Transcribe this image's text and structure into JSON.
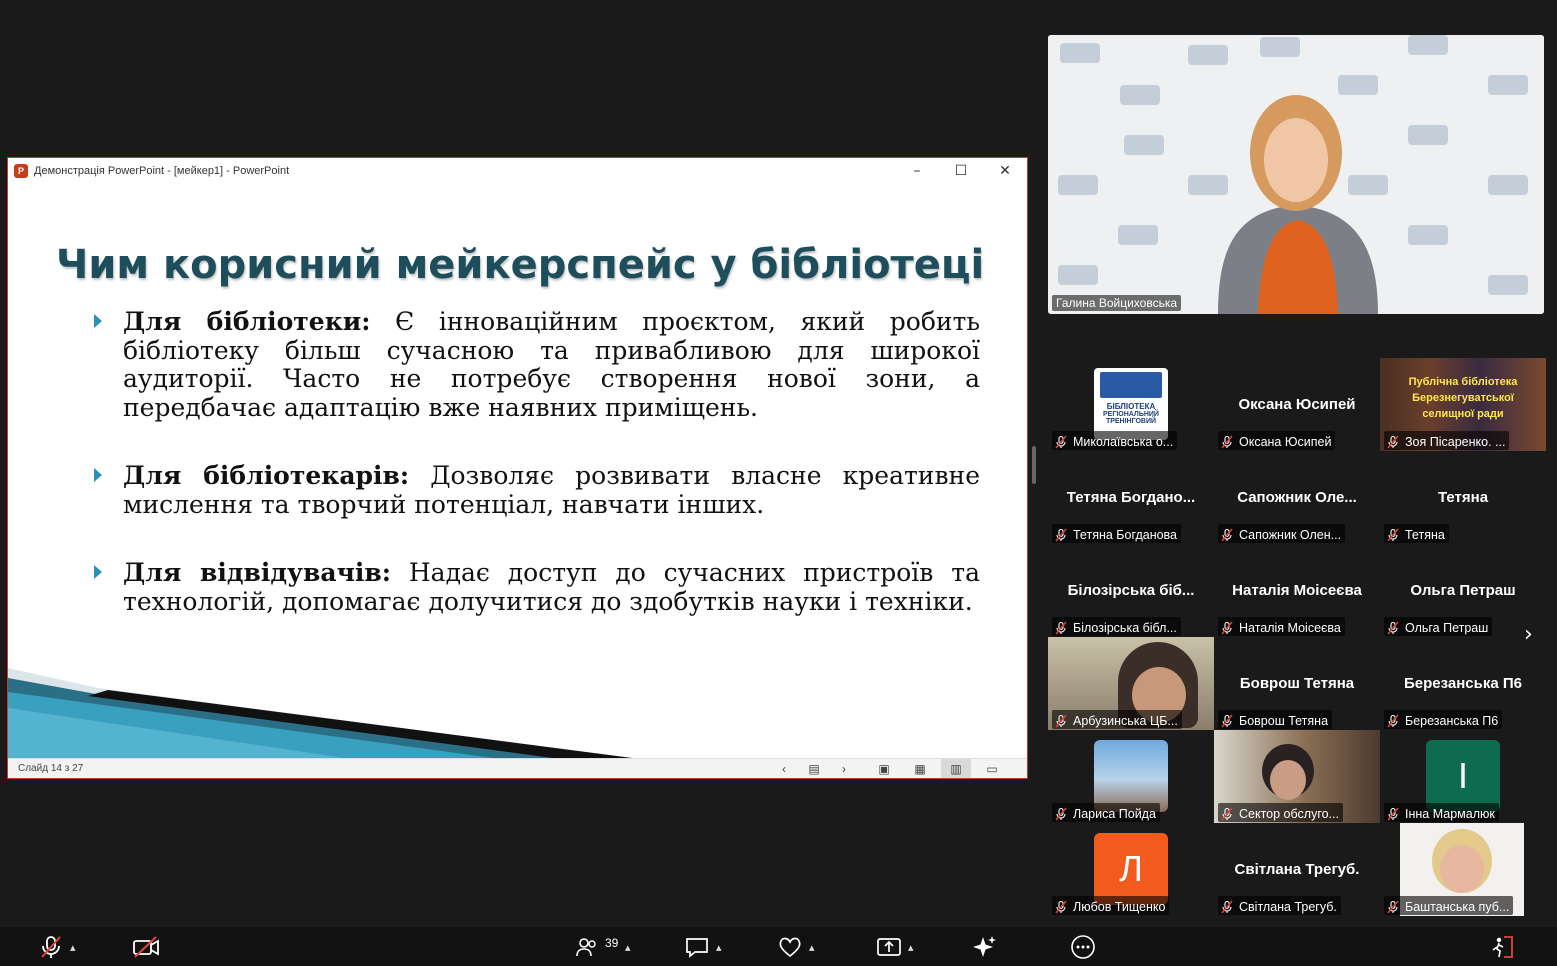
{
  "ppt_window": {
    "title": "Демонстрація PowerPoint - [мейкер1] - PowerPoint",
    "min_glyph": "–",
    "max_glyph": "☐",
    "close_glyph": "✕",
    "status_slide": "Слайд 14 з 27"
  },
  "slide": {
    "title": "Чим корисний мейкерспейс у бібліотеці",
    "bullets": [
      {
        "lead": "Для бібліотеки:",
        "text": " Є інноваційним проєктом, який робить бібліотеку більш сучасною та привабливою для широкої аудиторії.  Часто не потребує створення нової зони, а передбачає адаптацію вже наявних приміщень."
      },
      {
        "lead": "Для бібліотекарів:",
        "text": " Дозволяє розвивати власне креативне мислення та творчий потенціал, навчати інших."
      },
      {
        "lead": "Для відвідувачів:",
        "text": " Надає доступ до сучасних пристроїв та технологій, допомагає долучитися до здобутків науки і техніки."
      }
    ],
    "accent_color": "#2e8fb5",
    "title_color": "#1e4e5c"
  },
  "speaker": {
    "name": "Галина Войциховська"
  },
  "gallery": [
    {
      "big": "",
      "label": "Миколаївська о...",
      "kind": "logo"
    },
    {
      "big": "Оксана Юсипей",
      "label": "Оксана Юсипей",
      "kind": "name"
    },
    {
      "big": "",
      "label": "Зоя Пісаренко. ...",
      "kind": "library",
      "overlay1": "Публічна бібліотека",
      "overlay2": "Березнегуватської",
      "overlay3": "селищної ради"
    },
    {
      "big": "Тетяна Богдано...",
      "label": "Тетяна Богданова",
      "kind": "name"
    },
    {
      "big": "Сапожник Оле...",
      "label": "Сапожник Олен...",
      "kind": "name"
    },
    {
      "big": "Тетяна",
      "label": "Тетяна",
      "kind": "name"
    },
    {
      "big": "Білозірська біб...",
      "label": "Білозірська бібл...",
      "kind": "name"
    },
    {
      "big": "Наталія Моісеєва",
      "label": "Наталія Моісеєва",
      "kind": "name"
    },
    {
      "big": "Ольга Петраш",
      "label": "Ольга Петраш",
      "kind": "name"
    },
    {
      "big": "",
      "label": "Арбузинська ЦБ...",
      "kind": "video"
    },
    {
      "big": "Боврош Тетяна",
      "label": "Боврош Тетяна",
      "kind": "name"
    },
    {
      "big": "Березанська П6",
      "label": "Березанська П6",
      "kind": "name"
    },
    {
      "big": "",
      "label": "Лариса Пойда",
      "kind": "photo"
    },
    {
      "big": "",
      "label": "Сектор обслуго...",
      "kind": "video2"
    },
    {
      "big": "",
      "label": "Інна Мармалюк",
      "kind": "avatar",
      "letter": "І",
      "color": "#0e6b4f"
    },
    {
      "big": "",
      "label": "Любов Тищенко",
      "kind": "avatar",
      "letter": "Л",
      "color": "#f25a1e"
    },
    {
      "big": "Світлана Трегуб.",
      "label": "Світлана Трегуб.",
      "kind": "name"
    },
    {
      "big": "",
      "label": "Баштанська пуб...",
      "kind": "video3"
    }
  ],
  "logo_text": {
    "line1": "БІБЛІОТЕКА",
    "line2": "РЕГІОНАЛЬНИЙ",
    "line3": "ТРЕНІНГОВИЙ"
  },
  "toolbar": {
    "participants_count": "39"
  }
}
